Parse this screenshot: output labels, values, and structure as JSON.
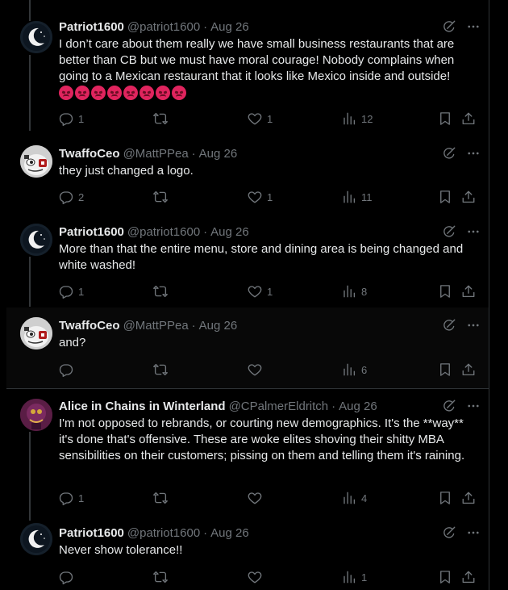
{
  "icons": {
    "reply": "reply-icon",
    "retweet": "retweet-icon",
    "like": "like-icon",
    "views": "views-icon",
    "bookmark": "bookmark-icon",
    "share": "share-icon",
    "grok": "grok-icon",
    "more": "more-icon"
  },
  "colors": {
    "background": "#000000",
    "muted": "#71767b",
    "text": "#e7e9ea",
    "emoji": "#e0245e"
  },
  "tweets": [
    {
      "name": "Patriot1600",
      "handle": "@patriot1600",
      "dot": "·",
      "date": "Aug 26",
      "text": "I don’t care about them really we have small business restaurants that are better than CB but we must have moral courage! Nobody complains when going to a Mexican restaurant that it looks like Mexico inside and outside!",
      "emoji_count": 8,
      "replies": "1",
      "retweets": "",
      "likes": "1",
      "views": "12"
    },
    {
      "name": "TwaffoCeo",
      "handle": "@MattPPea",
      "dot": "·",
      "date": "Aug 26",
      "text": "they just changed a logo.",
      "replies": "2",
      "retweets": "",
      "likes": "1",
      "views": "11"
    },
    {
      "name": "Patriot1600",
      "handle": "@patriot1600",
      "dot": "·",
      "date": "Aug 26",
      "text": "More than that the entire menu, store and dining area is being changed and white washed!",
      "replies": "1",
      "retweets": "",
      "likes": "1",
      "views": "8"
    },
    {
      "name": "TwaffoCeo",
      "handle": "@MattPPea",
      "dot": "·",
      "date": "Aug 26",
      "text": "and?",
      "replies": "",
      "retweets": "",
      "likes": "",
      "views": "6"
    },
    {
      "name": "Alice in Chains in Winterland",
      "handle": "@CPalmerEldritch",
      "dot": "·",
      "date": "Aug 26",
      "text": "I'm not opposed to rebrands, or courting new demographics. It's the **way** it's done that's offensive. These are woke elites shoving their shitty MBA sensibilities on their customers; pissing on them and telling them it's raining.",
      "replies": "1",
      "retweets": "",
      "likes": "",
      "views": "4"
    },
    {
      "name": "Patriot1600",
      "handle": "@patriot1600",
      "dot": "·",
      "date": "Aug 26",
      "text": "Never show tolerance!!",
      "replies": "",
      "retweets": "",
      "likes": "",
      "views": "1"
    }
  ]
}
